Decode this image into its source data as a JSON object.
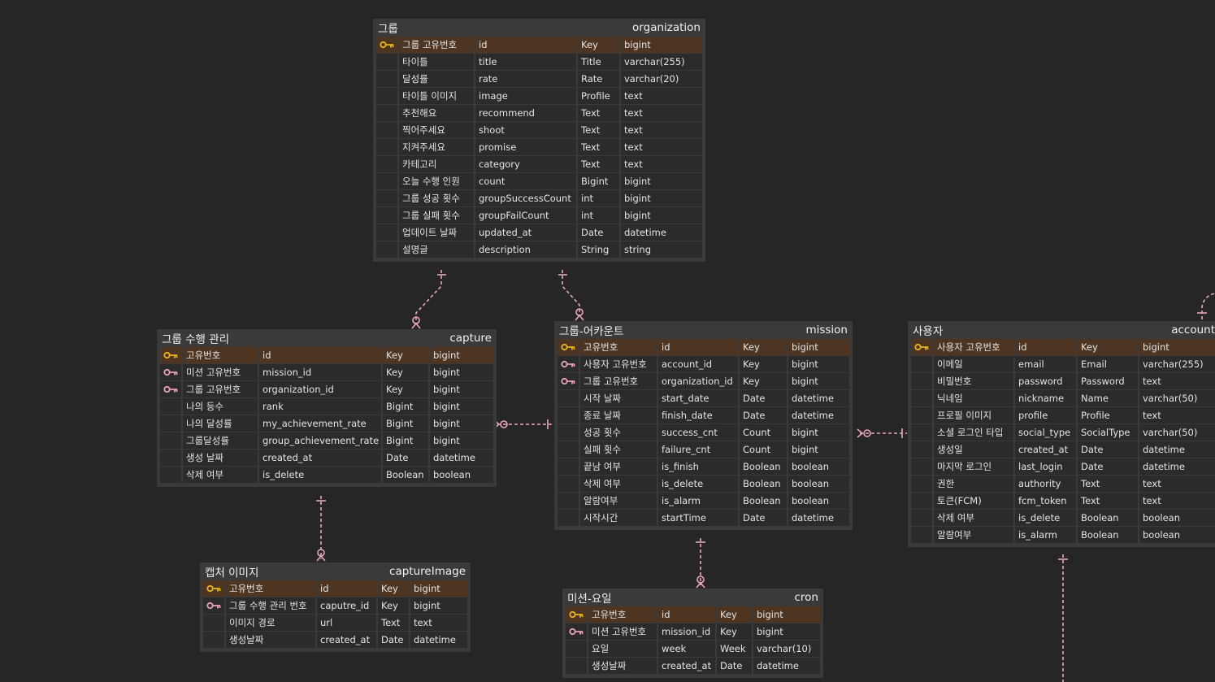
{
  "entities": [
    {
      "id": "organization",
      "label": "그룹",
      "table": "organization",
      "rows": [
        {
          "key": "pk",
          "name": "그룹 고유번호",
          "column": "id",
          "kind": "Key",
          "type": "bigint"
        },
        {
          "key": "",
          "name": "타이틀",
          "column": "title",
          "kind": "Title",
          "type": "varchar(255)"
        },
        {
          "key": "",
          "name": "달성률",
          "column": "rate",
          "kind": "Rate",
          "type": "varchar(20)"
        },
        {
          "key": "",
          "name": "타이틀 이미지",
          "column": "image",
          "kind": "Profile",
          "type": "text"
        },
        {
          "key": "",
          "name": "추천해요",
          "column": "recommend",
          "kind": "Text",
          "type": "text"
        },
        {
          "key": "",
          "name": "찍어주세요",
          "column": "shoot",
          "kind": "Text",
          "type": "text"
        },
        {
          "key": "",
          "name": "지켜주세요",
          "column": "promise",
          "kind": "Text",
          "type": "text"
        },
        {
          "key": "",
          "name": "카테고리",
          "column": "category",
          "kind": "Text",
          "type": "text"
        },
        {
          "key": "",
          "name": "오늘 수행 인원",
          "column": "count",
          "kind": "Bigint",
          "type": "bigint"
        },
        {
          "key": "",
          "name": "그룹 성공 횟수",
          "column": "groupSuccessCount",
          "kind": "int",
          "type": "bigint"
        },
        {
          "key": "",
          "name": "그룹 실패 횟수",
          "column": "groupFailCount",
          "kind": "int",
          "type": "bigint"
        },
        {
          "key": "",
          "name": "업데이트 날짜",
          "column": "updated_at",
          "kind": "Date",
          "type": "datetime"
        },
        {
          "key": "",
          "name": "설명글",
          "column": "description",
          "kind": "String",
          "type": "string"
        }
      ]
    },
    {
      "id": "capture",
      "label": "그룹 수행 관리",
      "table": "capture",
      "rows": [
        {
          "key": "pk",
          "name": "고유번호",
          "column": "id",
          "kind": "Key",
          "type": "bigint"
        },
        {
          "key": "fk",
          "name": "미션 고유번호",
          "column": "mission_id",
          "kind": "Key",
          "type": "bigint"
        },
        {
          "key": "fk",
          "name": "그룹 고유번호",
          "column": "organization_id",
          "kind": "Key",
          "type": "bigint"
        },
        {
          "key": "",
          "name": "나의 등수",
          "column": "rank",
          "kind": "Bigint",
          "type": "bigint"
        },
        {
          "key": "",
          "name": "나의 달성률",
          "column": "my_achievement_rate",
          "kind": "Bigint",
          "type": "bigint"
        },
        {
          "key": "",
          "name": "그룹달성률",
          "column": "group_achievement_rate",
          "kind": "Bigint",
          "type": "bigint"
        },
        {
          "key": "",
          "name": "생성 날짜",
          "column": "created_at",
          "kind": "Date",
          "type": "datetime"
        },
        {
          "key": "",
          "name": "삭제 여부",
          "column": "is_delete",
          "kind": "Boolean",
          "type": "boolean"
        }
      ]
    },
    {
      "id": "mission",
      "label": "그룹-어카운트",
      "table": "mission",
      "rows": [
        {
          "key": "pk",
          "name": "고유번호",
          "column": "id",
          "kind": "Key",
          "type": "bigint"
        },
        {
          "key": "fk",
          "name": "사용자 고유번호",
          "column": "account_id",
          "kind": "Key",
          "type": "bigint"
        },
        {
          "key": "fk",
          "name": "그룹 고유번호",
          "column": "organization_id",
          "kind": "Key",
          "type": "bigint"
        },
        {
          "key": "",
          "name": "시작 날짜",
          "column": "start_date",
          "kind": "Date",
          "type": "datetime"
        },
        {
          "key": "",
          "name": "종료 날짜",
          "column": "finish_date",
          "kind": "Date",
          "type": "datetime"
        },
        {
          "key": "",
          "name": "성공 횟수",
          "column": "success_cnt",
          "kind": "Count",
          "type": "bigint"
        },
        {
          "key": "",
          "name": "실패 횟수",
          "column": "failure_cnt",
          "kind": "Count",
          "type": "bigint"
        },
        {
          "key": "",
          "name": "끝남 여부",
          "column": "is_finish",
          "kind": "Boolean",
          "type": "boolean"
        },
        {
          "key": "",
          "name": "삭제 여부",
          "column": "is_delete",
          "kind": "Boolean",
          "type": "boolean"
        },
        {
          "key": "",
          "name": "알람여부",
          "column": "is_alarm",
          "kind": "Boolean",
          "type": "boolean"
        },
        {
          "key": "",
          "name": "시작시간",
          "column": "startTime",
          "kind": "Date",
          "type": "datetime"
        }
      ]
    },
    {
      "id": "account",
      "label": "사용자",
      "table": "account",
      "rows": [
        {
          "key": "pk",
          "name": "사용자 고유번호",
          "column": "id",
          "kind": "Key",
          "type": "bigint"
        },
        {
          "key": "",
          "name": "이메일",
          "column": "email",
          "kind": "Email",
          "type": "varchar(255)"
        },
        {
          "key": "",
          "name": "비밀번호",
          "column": "password",
          "kind": "Password",
          "type": "text"
        },
        {
          "key": "",
          "name": "닉네임",
          "column": "nickname",
          "kind": "Name",
          "type": "varchar(50)"
        },
        {
          "key": "",
          "name": "프로필 이미지",
          "column": "profile",
          "kind": "Profile",
          "type": "text"
        },
        {
          "key": "",
          "name": "소셜 로그인 타입",
          "column": "social_type",
          "kind": "SocialType",
          "type": "varchar(50)"
        },
        {
          "key": "",
          "name": "생성일",
          "column": "created_at",
          "kind": "Date",
          "type": "datetime"
        },
        {
          "key": "",
          "name": "마지막 로그인",
          "column": "last_login",
          "kind": "Date",
          "type": "datetime"
        },
        {
          "key": "",
          "name": "권한",
          "column": "authority",
          "kind": "Text",
          "type": "text"
        },
        {
          "key": "",
          "name": "토큰(FCM)",
          "column": "fcm_token",
          "kind": "Text",
          "type": "text"
        },
        {
          "key": "",
          "name": "삭제 여부",
          "column": "is_delete",
          "kind": "Boolean",
          "type": "boolean"
        },
        {
          "key": "",
          "name": "알람여부",
          "column": "is_alarm",
          "kind": "Boolean",
          "type": "boolean"
        }
      ]
    },
    {
      "id": "captureImage",
      "label": "캡처 이미지",
      "table": "captureImage",
      "rows": [
        {
          "key": "pk",
          "name": "고유번호",
          "column": "id",
          "kind": "Key",
          "type": "bigint"
        },
        {
          "key": "fk",
          "name": "그룹 수행 관리 번호",
          "column": "caputre_id",
          "kind": "Key",
          "type": "bigint"
        },
        {
          "key": "",
          "name": "이미지 경로",
          "column": "url",
          "kind": "Text",
          "type": "text"
        },
        {
          "key": "",
          "name": "생성날짜",
          "column": "created_at",
          "kind": "Date",
          "type": "datetime"
        }
      ]
    },
    {
      "id": "cron",
      "label": "미션-요일",
      "table": "cron",
      "rows": [
        {
          "key": "pk",
          "name": "고유번호",
          "column": "id",
          "kind": "Key",
          "type": "bigint"
        },
        {
          "key": "fk",
          "name": "미션 고유번호",
          "column": "mission_id",
          "kind": "Key",
          "type": "bigint"
        },
        {
          "key": "",
          "name": "요일",
          "column": "week",
          "kind": "Week",
          "type": "varchar(10)"
        },
        {
          "key": "",
          "name": "생성날짜",
          "column": "created_at",
          "kind": "Date",
          "type": "datetime"
        }
      ]
    }
  ],
  "colors": {
    "background": "#262626",
    "entity_frame": "#3a3a3a",
    "pk_row": "#4e3521",
    "pk_icon": "#e6b422",
    "fk_icon": "#e8a0c0",
    "relationship_line": "#e8a8b8"
  },
  "icons": {
    "pk": "key-icon",
    "fk": "key-icon"
  }
}
